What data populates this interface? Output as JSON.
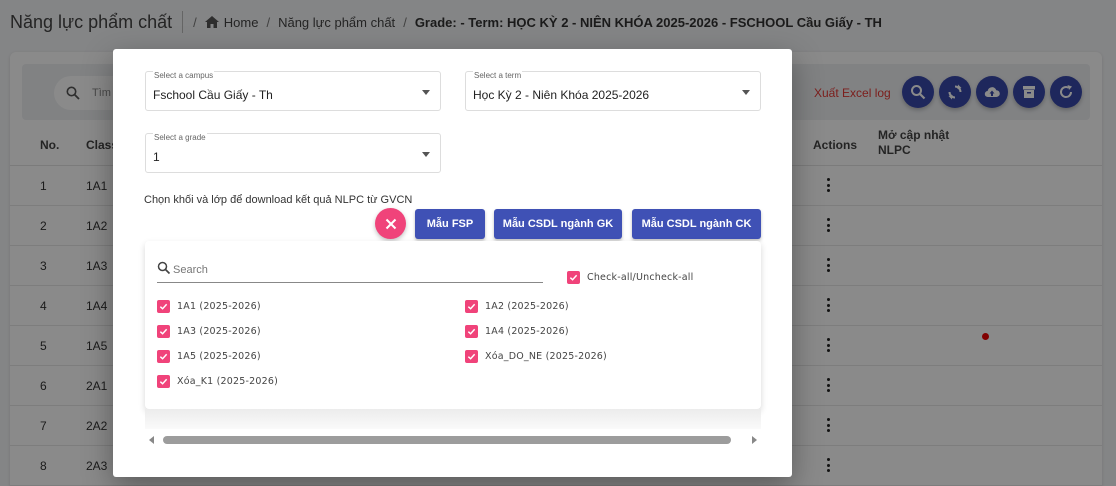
{
  "page": {
    "title": "Năng lực phẩm chất",
    "breadcrumb": {
      "home": "Home",
      "section": "Năng lực phẩm chất",
      "current": "Grade: - Term: HỌC KỲ 2 - NIÊN KHÓA 2025-2026 - FSCHOOL Cầu Giấy - TH"
    }
  },
  "toolbar": {
    "search_placeholder": "Tìm",
    "excel_log": "Xuất Excel log",
    "icons": [
      "search-icon",
      "sync-icon",
      "cloud-upload-icon",
      "archive-icon",
      "refresh-icon"
    ]
  },
  "table": {
    "headers": {
      "no": "No.",
      "class": "Class",
      "actions": "Actions",
      "update_1": "Mở cập nhật",
      "update_2": "NLPC"
    },
    "rows": [
      {
        "no": "1",
        "class": "1A1"
      },
      {
        "no": "2",
        "class": "1A2"
      },
      {
        "no": "3",
        "class": "1A3"
      },
      {
        "no": "4",
        "class": "1A4"
      },
      {
        "no": "5",
        "class": "1A5"
      },
      {
        "no": "6",
        "class": "2A1"
      },
      {
        "no": "7",
        "class": "2A2"
      },
      {
        "no": "8",
        "class": "2A3"
      }
    ]
  },
  "modal": {
    "campus": {
      "label": "Select a campus",
      "value": "Fschool Cầu Giấy - Th"
    },
    "term": {
      "label": "Select a term",
      "value": "Học Kỳ 2 - Niên Khóa 2025-2026"
    },
    "grade": {
      "label": "Select a grade",
      "value": "1"
    },
    "helper_text": "Chọn khối và lớp để download kết quả NLPC từ GVCN",
    "buttons": {
      "fsp": "Mẫu FSP",
      "csdl_gk": "Mẫu CSDL ngành GK",
      "csdl_ck": "Mẫu CSDL ngành CK"
    },
    "search_placeholder": "Search",
    "check_all_label": "Check-all/Uncheck-all",
    "check_all_checked": true,
    "classes": [
      {
        "label": "1A1 (2025-2026)",
        "checked": true
      },
      {
        "label": "1A2 (2025-2026)",
        "checked": true
      },
      {
        "label": "1A3 (2025-2026)",
        "checked": true
      },
      {
        "label": "1A4 (2025-2026)",
        "checked": true
      },
      {
        "label": "1A5 (2025-2026)",
        "checked": true
      },
      {
        "label": "Xóa_DO_NE (2025-2026)",
        "checked": true
      },
      {
        "label": "Xóa_K1 (2025-2026)",
        "checked": true
      }
    ]
  },
  "colors": {
    "primary": "#3f51b5",
    "accent_pink": "#f0437a",
    "excel_red": "#e53935",
    "overlay": "rgba(0,0,0,0.46)"
  }
}
